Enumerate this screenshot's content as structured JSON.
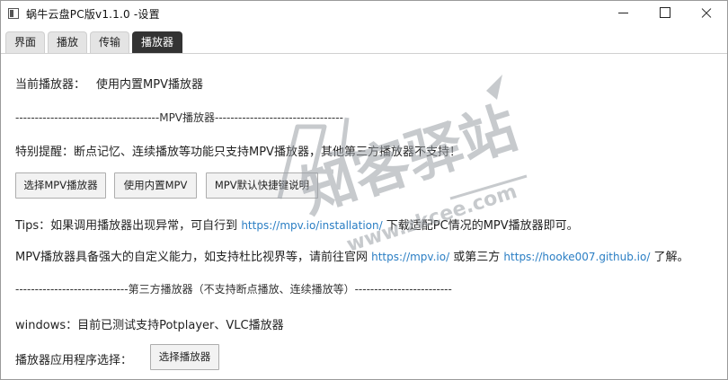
{
  "window": {
    "title": "蜗牛云盘PC版v1.1.0 -设置"
  },
  "tabs": [
    {
      "label": "界面",
      "active": false
    },
    {
      "label": "播放",
      "active": false
    },
    {
      "label": "传输",
      "active": false
    },
    {
      "label": "播放器",
      "active": true
    }
  ],
  "player": {
    "current_label": "当前播放器：",
    "current_value": "使用内置MPV播放器",
    "mpv_divider": "-------------------------------------MPV播放器---------------------------------",
    "notice": "特别提醒：断点记忆、连续播放等功能只支持MPV播放器，其他第三方播放器不支持！",
    "buttons": {
      "select_mpv": "选择MPV播放器",
      "use_builtin": "使用内置MPV",
      "shortcuts": "MPV默认快捷键说明"
    },
    "tips_prefix": "Tips：如果调用播放器出现异常，可自行到",
    "tips_link": "https://mpv.io/installation/",
    "tips_suffix": "下载适配PC情况的MPV播放器即可。",
    "custom_prefix": "MPV播放器具备强大的自定义能力，如支持杜比视界等，请前往官网",
    "custom_link1": "https://mpv.io/",
    "custom_middle": "或第三方",
    "custom_link2": "https://hooke007.github.io/",
    "custom_suffix": "了解。",
    "third_divider": "-----------------------------第三方播放器（不支持断点播放、连续播放等）-------------------------",
    "windows_info": "windows：目前已测试支持Potplayer、VLC播放器",
    "app_select_label": "播放器应用程序选择：",
    "app_select_button": "选择播放器"
  },
  "watermark": {
    "main": "知客驿站",
    "domain": "www.zkcee.com"
  },
  "colors": {
    "link": "#2a7ec4",
    "active_tab": "#333333",
    "watermark": "#9aa0a6"
  }
}
